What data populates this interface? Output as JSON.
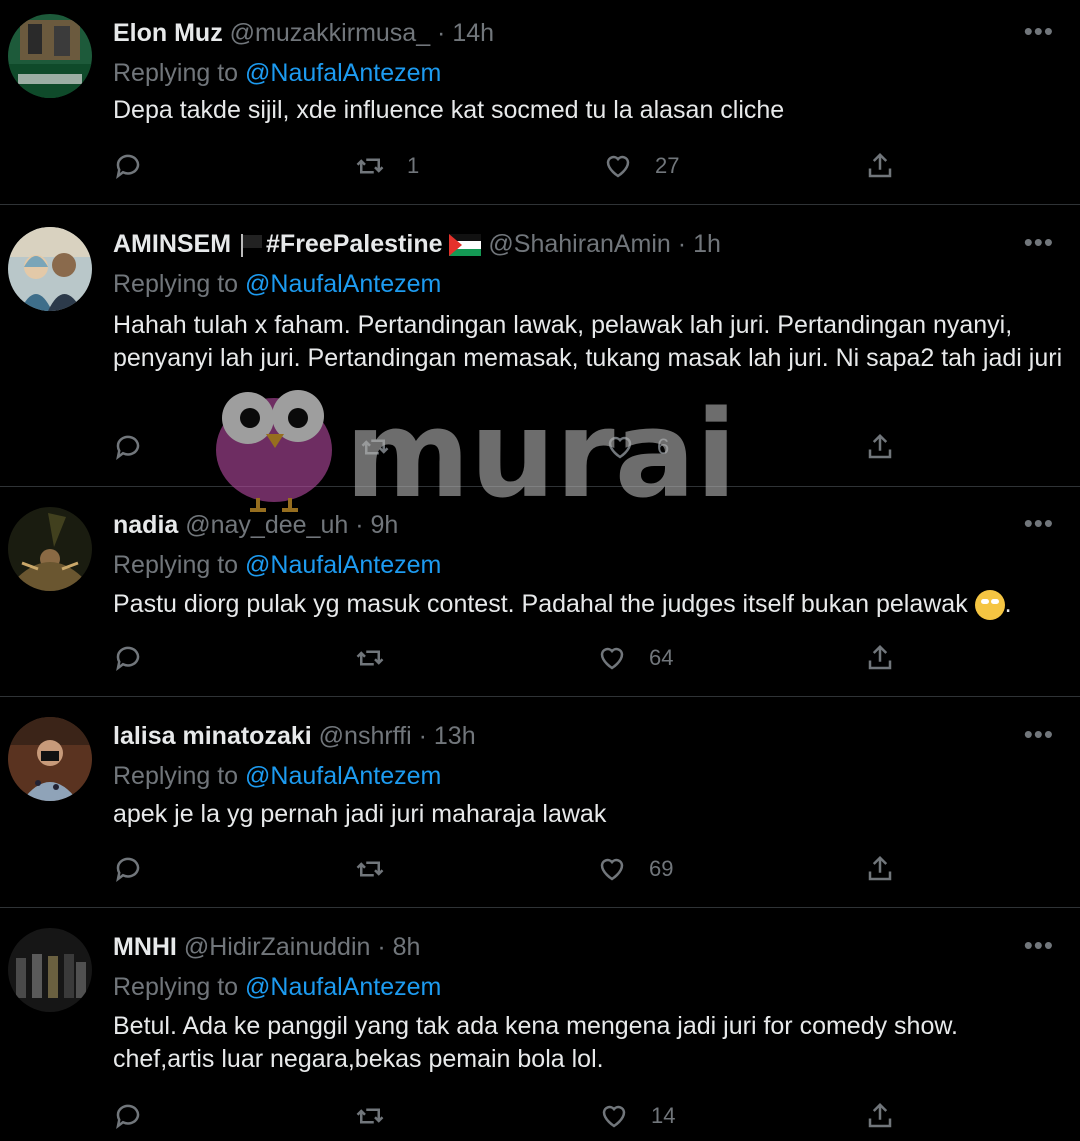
{
  "tweets": [
    {
      "name": "Elon Muz",
      "handle": "@muzakkirmusa_",
      "time": "14h",
      "replying_prefix": "Replying to ",
      "replying_to": "@NaufalAntezem",
      "text": "Depa takde sijil, xde influence kat socmed tu la alasan cliche",
      "retweets": "1",
      "likes": "27"
    },
    {
      "name": "AMINSEM",
      "name_suffix": "#FreePalestine",
      "handle": "@ShahiranAmin",
      "time": "1h",
      "replying_prefix": "Replying to ",
      "replying_to": "@NaufalAntezem",
      "text": "Hahah tulah x faham. Pertandingan lawak, pelawak lah juri. Pertandingan nyanyi, penyanyi lah juri. Pertandingan memasak, tukang masak lah juri. Ni sapa2 tah jadi juri",
      "retweets": "",
      "likes": "6"
    },
    {
      "name": "nadia",
      "handle": "@nay_dee_uh",
      "time": "9h",
      "replying_prefix": "Replying to ",
      "replying_to": "@NaufalAntezem",
      "text": "Pastu diorg pulak yg masuk contest. Padahal the judges itself bukan pelawak",
      "text_end": ".",
      "retweets": "",
      "likes": "64"
    },
    {
      "name": "lalisa minatozaki",
      "handle": "@nshrffi",
      "time": "13h",
      "replying_prefix": "Replying to ",
      "replying_to": "@NaufalAntezem",
      "text": "apek je la yg pernah jadi juri maharaja lawak",
      "retweets": "",
      "likes": "69"
    },
    {
      "name": "MNHI",
      "handle": "@HidirZainuddin",
      "time": "8h",
      "replying_prefix": "Replying to ",
      "replying_to": "@NaufalAntezem",
      "text": "Betul. Ada ke panggil yang tak ada kena mengena jadi juri for comedy show. chef,artis luar negara,bekas pemain bola lol.",
      "retweets": "",
      "likes": "14"
    }
  ],
  "separator": " · ",
  "watermark": "murai",
  "colors": {
    "background": "#000000",
    "text": "#e7e9ea",
    "muted": "#71767b",
    "mention": "#1d9bf0",
    "divider": "#2f3336"
  }
}
